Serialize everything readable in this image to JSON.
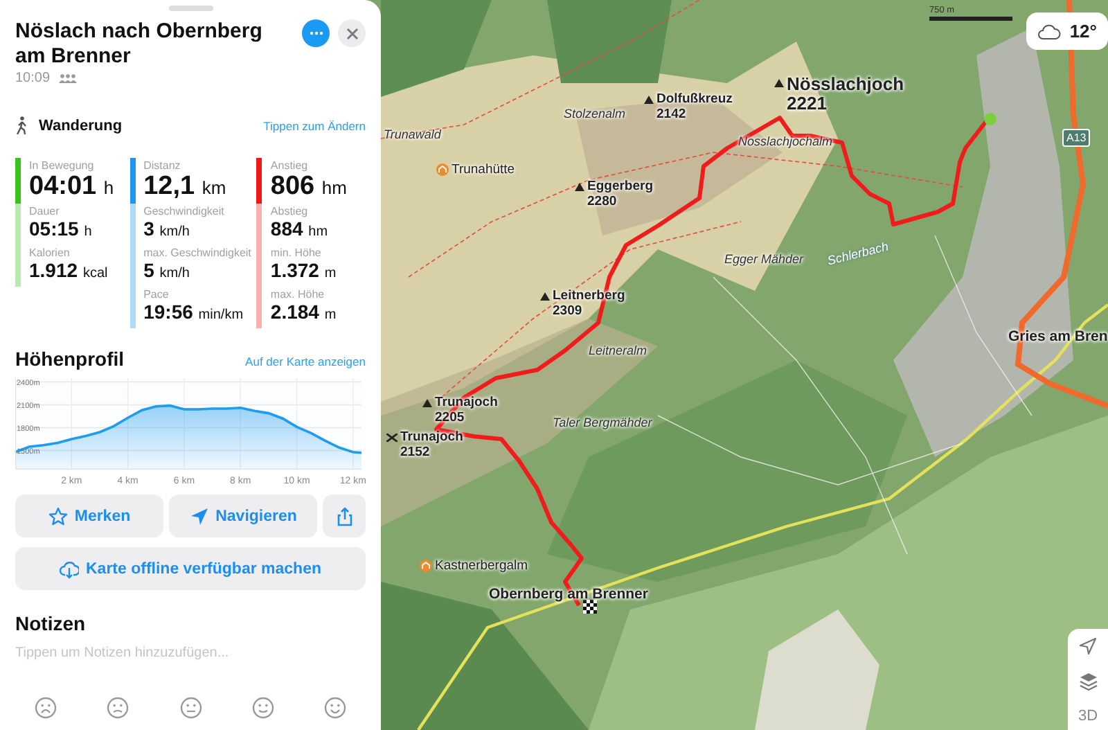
{
  "route": {
    "title": "Nöslach nach Obernberg am Brenner",
    "time": "10:09",
    "activity": "Wanderung",
    "change_link": "Tippen zum Ändern"
  },
  "stats": [
    {
      "color": "#38c41c",
      "items": [
        {
          "label": "In Bewegung",
          "value": "04:01",
          "unit": "h"
        },
        {
          "label": "Dauer",
          "value": "05:15",
          "unit": "h"
        },
        {
          "label": "Kalorien",
          "value": "1.912",
          "unit": "kcal"
        }
      ]
    },
    {
      "color": "#1e96f0",
      "items": [
        {
          "label": "Distanz",
          "value": "12,1",
          "unit": "km"
        },
        {
          "label": "Geschwindigkeit",
          "value": "3",
          "unit": "km/h"
        },
        {
          "label": "max. Geschwindigkeit",
          "value": "5",
          "unit": "km/h"
        },
        {
          "label": "Pace",
          "value": "19:56",
          "unit": "min/km"
        }
      ]
    },
    {
      "color": "#f01818",
      "items": [
        {
          "label": "Anstieg",
          "value": "806",
          "unit": "hm"
        },
        {
          "label": "Abstieg",
          "value": "884",
          "unit": "hm"
        },
        {
          "label": "min. Höhe",
          "value": "1.372",
          "unit": "m"
        },
        {
          "label": "max. Höhe",
          "value": "2.184",
          "unit": "m"
        }
      ]
    }
  ],
  "profile": {
    "title": "Höhenprofil",
    "link": "Auf der Karte anzeigen",
    "chart_data": {
      "type": "area",
      "x": [
        0,
        0.5,
        1,
        1.5,
        2,
        2.5,
        3,
        3.5,
        4,
        4.5,
        5,
        5.5,
        6,
        6.5,
        7,
        7.5,
        8,
        8.5,
        9,
        9.5,
        10,
        10.5,
        11,
        11.5,
        12,
        12.3
      ],
      "grid": true,
      "series": [
        {
          "color": "#1e9cf0",
          "values": [
            1480,
            1550,
            1570,
            1600,
            1650,
            1690,
            1740,
            1820,
            1930,
            2030,
            2080,
            2090,
            2040,
            2040,
            2050,
            2050,
            2060,
            2020,
            1990,
            1920,
            1810,
            1730,
            1630,
            1540,
            1480,
            1470
          ]
        }
      ],
      "xlim": [
        0,
        12.3
      ],
      "ylim": [
        1250,
        2450
      ],
      "xticks": [
        {
          "value": 2,
          "label": "2 km"
        },
        {
          "value": 4,
          "label": "4 km"
        },
        {
          "value": 6,
          "label": "6 km"
        },
        {
          "value": 8,
          "label": "8 km"
        },
        {
          "value": 10,
          "label": "10 km"
        },
        {
          "value": 12,
          "label": "12 km"
        }
      ],
      "yticks": [
        {
          "value": 1500,
          "label": "1500m"
        },
        {
          "value": 1800,
          "label": "1800m"
        },
        {
          "value": 2100,
          "label": "2100m"
        },
        {
          "value": 2400,
          "label": "2400m"
        }
      ]
    }
  },
  "actions": [
    {
      "kind": "save",
      "label": "Merken"
    },
    {
      "kind": "navigate",
      "label": "Navigieren"
    },
    {
      "kind": "share"
    },
    {
      "kind": "offline",
      "label": "Karte offline verfügbar machen"
    }
  ],
  "notes": {
    "title": "Notizen",
    "placeholder": "Tippen um Notizen hinzuzufügen..."
  },
  "map": {
    "scale": "750 m",
    "weather": {
      "temperature": "12°"
    },
    "view_toggle": "3D",
    "labels": [
      {
        "kind": "peak",
        "name": "Dolfußkreuz",
        "elevation": "2142"
      },
      {
        "kind": "peak",
        "name": "Nösslachjoch",
        "elevation": "2221"
      },
      {
        "kind": "area",
        "name": "Stolzenalm"
      },
      {
        "kind": "area",
        "name": "Trunawald"
      },
      {
        "kind": "hut",
        "name": "Trunahütte"
      },
      {
        "kind": "peak",
        "name": "Eggerberg",
        "elevation": "2280"
      },
      {
        "kind": "area",
        "name": "Nosslachjochalm"
      },
      {
        "kind": "area",
        "name": "Egger Mähder"
      },
      {
        "kind": "water",
        "name": "Schlerbach"
      },
      {
        "kind": "peak",
        "name": "Leitnerberg",
        "elevation": "2309"
      },
      {
        "kind": "area",
        "name": "Leitneralm"
      },
      {
        "kind": "peak",
        "name": "Trunajoch",
        "elevation": "2205"
      },
      {
        "kind": "pass",
        "name": "Trunajoch",
        "elevation": "2152"
      },
      {
        "kind": "area",
        "name": "Taler Bergmähder"
      },
      {
        "kind": "hut",
        "name": "Kastnerbergalm"
      },
      {
        "kind": "town",
        "name": "Obernberg am Brenner"
      },
      {
        "kind": "town",
        "name": "Gries am Bren"
      },
      {
        "kind": "road",
        "name": "A13"
      }
    ]
  }
}
